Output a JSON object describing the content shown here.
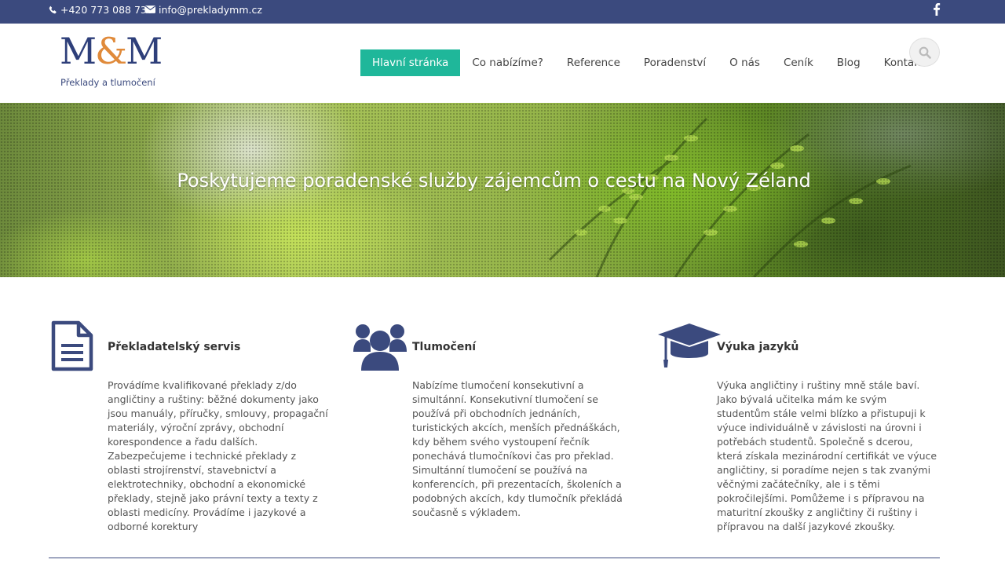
{
  "topbar": {
    "phone": "+420 773 088 736",
    "email": "info@prekladymm.cz",
    "icons": [
      "phone-icon",
      "envelope-icon",
      "facebook-icon"
    ]
  },
  "logo": {
    "m1": "M",
    "amp": "&",
    "m2": "M",
    "subtitle": "Překlady a tlumočení"
  },
  "nav": {
    "items": [
      {
        "label": "Hlavní stránka",
        "active": true
      },
      {
        "label": "Co nabízíme?"
      },
      {
        "label": "Reference"
      },
      {
        "label": "Poradenství"
      },
      {
        "label": "O nás"
      },
      {
        "label": "Ceník"
      },
      {
        "label": "Blog"
      },
      {
        "label": "Kontakt"
      }
    ],
    "search_icon": "search-icon"
  },
  "hero": {
    "title": "Poskytujeme poradenské služby zájemcům o cestu na Nový Zéland"
  },
  "services": [
    {
      "icon": "document-icon",
      "title": "Překladatelský servis",
      "text": "Provádíme kvalifikované překlady z/do angličtiny a ruštiny: běžné dokumenty jako jsou manuály, příručky, smlouvy, propagační materiály, výroční zprávy, obchodní korespondence a řadu dalších. Zabezpečujeme i technické překlady z oblasti strojírenství, stavebnictví a elektrotechniky, obchodní a ekonomické překlady, stejně jako právní texty a texty z oblasti medicíny. Provádíme i jazykové a odborné korektury"
    },
    {
      "icon": "users-icon",
      "title": "Tlumočení",
      "text": "Nabízíme tlumočení konsekutivní a simultánní. Konsekutivní tlumočení se používá při obchodních jednáních, turistických akcích, menších přednáškách, kdy během svého vystoupení řečník ponechává tlumočníkovi čas pro překlad. Simultánní tlumočení se používá na konferencích, při prezentacích, školeních a podobných akcích, kdy tlumočník překládá současně s výkladem."
    },
    {
      "icon": "graduation-cap-icon",
      "title": "Výuka jazyků",
      "text": "Výuka angličtiny i ruštiny mně stále baví. Jako bývalá učitelka mám ke svým studentům stále velmi blízko a přistupuji k výuce individuálně v závislosti na úrovni i potřebách studentů. Společně s dcerou, která získala mezinárodní certifikát ve výuce angličtiny, si poradíme nejen s tak zvanými věčnými začátečníky, ale i s těmi pokročilejšími. Pomůžeme i s přípravou na maturitní zkoušky z angličtiny či ruštiny i přípravou na další jazykové zkoušky."
    }
  ],
  "colors": {
    "brand_blue": "#3b4a7e",
    "accent_orange": "#e08a3a",
    "nav_active": "#1fb79a"
  }
}
